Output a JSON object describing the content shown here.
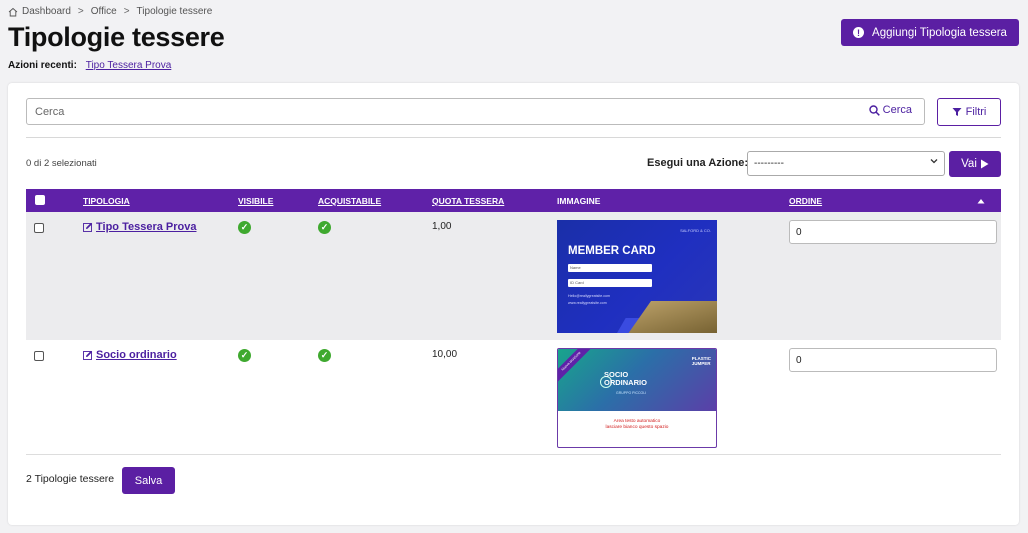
{
  "breadcrumb": {
    "items": [
      "Dashboard",
      "Office",
      "Tipologie tessere"
    ],
    "separator": ">"
  },
  "header": {
    "title": "Tipologie tessere",
    "recent_label": "Azioni recenti",
    "recent_link": "Tipo Tessera Prova",
    "add_button": "Aggiungi Tipologia tessera"
  },
  "search": {
    "placeholder": "Cerca",
    "button_label": "Cerca",
    "filter_label": "Filtri"
  },
  "bulk": {
    "selected_text": "0 di 2 selezionati",
    "action_label": "Esegui una Azione:",
    "action_value": "---------",
    "go_label": "Vai"
  },
  "table": {
    "headers": [
      "TIPOLOGIA",
      "VISIBILE",
      "ACQUISTABILE",
      "QUOTA TESSERA",
      "IMMAGINE",
      "ORDINE"
    ],
    "rows": [
      {
        "name": "Tipo Tessera Prova",
        "visible": true,
        "purchasable": true,
        "fee": "1,00",
        "order": "0",
        "image": {
          "title": "MEMBER CARD",
          "brand": "SALFORD & CO.",
          "field1": "Name",
          "field2": "ID Card",
          "line1": "Hello@reallygreatsite.com",
          "line2": "www.reallygreatsite.com"
        }
      },
      {
        "name": "Socio ordinario",
        "visible": true,
        "purchasable": true,
        "fee": "10,00",
        "order": "0",
        "image": {
          "ribbon": "Nuova iscrizione",
          "title1": "SOCIO",
          "title2": "ORDINARIO",
          "subtitle": "GRUPPO PICCOLI",
          "logo1": "PLASTIC",
          "logo2": "JUMPER",
          "note1": "Area testo automatico",
          "note2": "lasciare bianco questo spazio"
        }
      }
    ]
  },
  "footer": {
    "count_text": "2 Tipologie tessere",
    "save_label": "Salva"
  },
  "colors": {
    "primary": "#5b1fa3",
    "header_bg": "#5f21a8",
    "check_green": "#3fa92f",
    "page_bg": "#f2f2f4"
  },
  "icons": {
    "home": "home-icon",
    "info": "info-icon",
    "search": "search-icon",
    "filter": "filter-icon",
    "play": "play-icon",
    "edit": "edit-icon",
    "check": "check-circle-icon",
    "sort": "sort-up-icon"
  }
}
